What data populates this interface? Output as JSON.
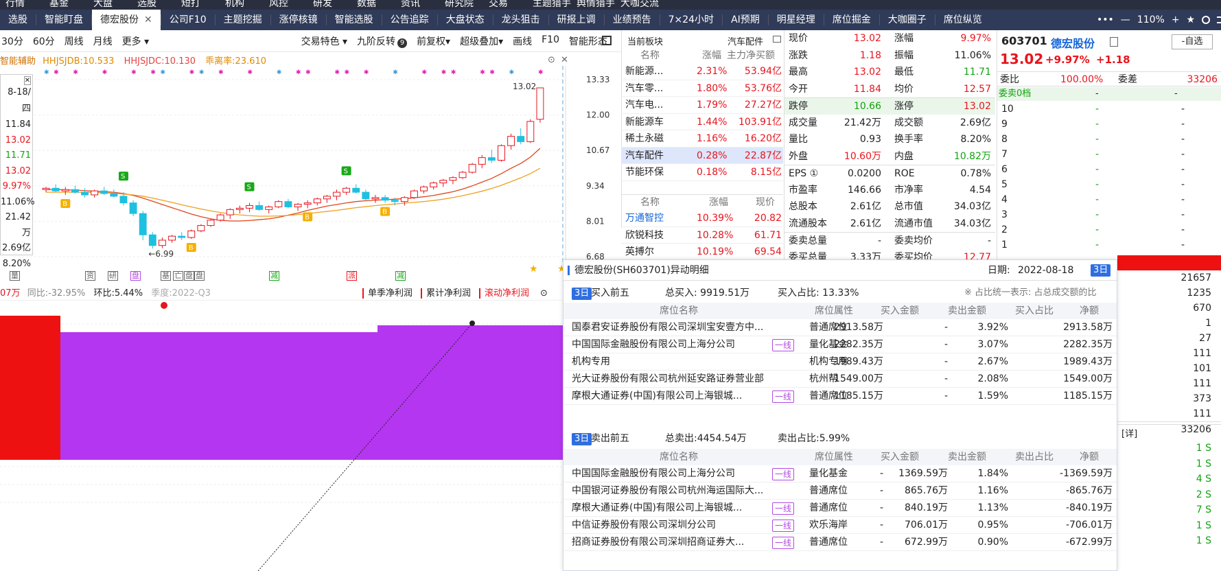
{
  "topnav": [
    "行情",
    "基金",
    "大盘",
    "选股",
    "短打",
    "机构",
    "风控",
    "研发",
    "数据",
    "资讯",
    "研究院",
    "交易",
    "主题猎手",
    "舆情猎手",
    "大咖交流"
  ],
  "tabs": [
    {
      "label": "选股",
      "active": false
    },
    {
      "label": "智能盯盘",
      "active": false
    },
    {
      "label": "德宏股份",
      "active": true
    },
    {
      "label": "公司F10",
      "active": false
    },
    {
      "label": "主题挖掘",
      "active": false
    },
    {
      "label": "涨停核镜",
      "active": false
    },
    {
      "label": "智能选股",
      "active": false
    },
    {
      "label": "公告追踪",
      "active": false
    },
    {
      "label": "大盘状态",
      "active": false
    },
    {
      "label": "龙头狙击",
      "active": false
    },
    {
      "label": "研报上调",
      "active": false
    },
    {
      "label": "业绩预告",
      "active": false
    },
    {
      "label": "7×24小时",
      "active": false
    },
    {
      "label": "AI预期",
      "active": false
    },
    {
      "label": "明星经理",
      "active": false
    },
    {
      "label": "席位掘金",
      "active": false
    },
    {
      "label": "大咖圈子",
      "active": false
    },
    {
      "label": "席位纵览",
      "active": false
    }
  ],
  "window": {
    "zoom": "110%",
    "more": "•••",
    "minimize": "—",
    "plus": "+",
    "star": "★",
    "search": "搜索"
  },
  "toolbar": {
    "periods": [
      "30分",
      "60分",
      "周线",
      "月线",
      "更多 ▾"
    ],
    "right": [
      "交易特色 ▾",
      "九阶反转",
      "前复权▾",
      "超级叠加▾",
      "画线",
      "F10",
      "智能形态"
    ],
    "nine_badge": "9"
  },
  "indicator": {
    "name": "智能辅助",
    "v1": "HHJSJDB:10.533",
    "v2": "HHJSJDC:10.130",
    "v3": "乖离率:23.610"
  },
  "tooltip": {
    "date": "8-18/四",
    "values": [
      {
        "v": "11.84",
        "c": "k"
      },
      {
        "v": "13.02",
        "c": "r"
      },
      {
        "v": "11.71",
        "c": "g"
      },
      {
        "v": "13.02",
        "c": "r"
      },
      {
        "v": "9.97%",
        "c": "r"
      },
      {
        "v": "11.06%",
        "c": "k"
      },
      {
        "v": "21.42万",
        "c": "k"
      },
      {
        "v": "2.69亿",
        "c": "k"
      },
      {
        "v": "8.20%",
        "c": "k"
      }
    ]
  },
  "price_axis": [
    "13.33",
    "12.00",
    "10.67",
    "9.34",
    "8.01",
    "6.68"
  ],
  "chart_marks": {
    "high": "13.02",
    "low": "←6.99"
  },
  "chart_data": {
    "type": "candlestick",
    "y_range": [
      6.68,
      13.33
    ],
    "series": [
      {
        "name": "K线",
        "values": [
          [
            9.2,
            9.3,
            9.1,
            9.25
          ],
          [
            9.25,
            9.4,
            9.1,
            9.15
          ],
          [
            9.15,
            9.3,
            9.0,
            9.2
          ],
          [
            9.2,
            9.35,
            9.05,
            9.1
          ],
          [
            9.1,
            9.25,
            8.9,
            9.0
          ],
          [
            9.0,
            9.2,
            8.9,
            9.15
          ],
          [
            9.15,
            9.3,
            9.0,
            9.05
          ],
          [
            9.05,
            9.2,
            8.9,
            8.95
          ],
          [
            8.95,
            9.1,
            8.6,
            8.7
          ],
          [
            8.7,
            8.8,
            8.2,
            8.3
          ],
          [
            8.3,
            8.4,
            7.3,
            7.5
          ],
          [
            7.5,
            7.6,
            6.99,
            7.1
          ],
          [
            7.1,
            7.4,
            7.0,
            7.3
          ],
          [
            7.3,
            7.5,
            7.2,
            7.45
          ],
          [
            7.45,
            7.6,
            7.3,
            7.4
          ],
          [
            7.4,
            7.7,
            7.35,
            7.65
          ],
          [
            7.65,
            7.9,
            7.6,
            7.85
          ],
          [
            7.85,
            8.1,
            7.8,
            8.05
          ],
          [
            8.05,
            8.3,
            8.0,
            8.25
          ],
          [
            8.25,
            8.5,
            8.1,
            8.45
          ],
          [
            8.45,
            8.6,
            8.3,
            8.5
          ],
          [
            8.5,
            8.7,
            8.35,
            8.6
          ],
          [
            8.6,
            8.75,
            8.4,
            8.45
          ],
          [
            8.45,
            8.6,
            8.3,
            8.55
          ],
          [
            8.55,
            8.8,
            8.5,
            8.75
          ],
          [
            8.75,
            8.85,
            8.5,
            8.55
          ],
          [
            8.55,
            8.7,
            8.4,
            8.65
          ],
          [
            8.65,
            8.8,
            8.5,
            8.7
          ],
          [
            8.7,
            8.9,
            8.6,
            8.85
          ],
          [
            8.85,
            9.0,
            8.7,
            8.95
          ],
          [
            8.95,
            9.2,
            8.8,
            9.1
          ],
          [
            9.1,
            9.3,
            9.0,
            9.25
          ],
          [
            9.25,
            9.4,
            9.05,
            9.1
          ],
          [
            9.1,
            9.2,
            8.8,
            8.85
          ],
          [
            8.85,
            9.0,
            8.7,
            8.9
          ],
          [
            8.9,
            9.0,
            8.7,
            8.8
          ],
          [
            8.8,
            8.9,
            8.6,
            8.75
          ],
          [
            8.75,
            8.95,
            8.6,
            8.9
          ],
          [
            8.9,
            9.2,
            8.85,
            9.15
          ],
          [
            9.15,
            9.35,
            9.05,
            9.3
          ],
          [
            9.3,
            9.5,
            9.2,
            9.45
          ],
          [
            9.45,
            9.6,
            9.3,
            9.55
          ],
          [
            9.55,
            9.7,
            9.4,
            9.65
          ],
          [
            9.65,
            9.9,
            9.6,
            9.85
          ],
          [
            9.85,
            10.2,
            9.8,
            10.15
          ],
          [
            10.15,
            10.5,
            10.0,
            10.4
          ],
          [
            10.4,
            10.7,
            10.2,
            10.3
          ],
          [
            10.3,
            10.9,
            10.25,
            10.85
          ],
          [
            10.85,
            11.3,
            10.7,
            11.2
          ],
          [
            11.2,
            11.5,
            10.9,
            11.0
          ],
          [
            11.0,
            11.84,
            10.95,
            11.76
          ],
          [
            11.84,
            13.02,
            11.71,
            13.02
          ]
        ]
      },
      {
        "name": "MA10",
        "values": [
          9.2,
          9.2,
          9.19,
          9.18,
          9.16,
          9.14,
          9.12,
          9.1,
          9.05,
          8.98,
          8.88,
          8.76,
          8.64,
          8.52,
          8.4,
          8.28,
          8.18,
          8.1,
          8.05,
          8.02,
          8.02,
          8.04,
          8.07,
          8.1,
          8.16,
          8.24,
          8.32,
          8.42,
          8.5,
          8.58,
          8.64,
          8.7,
          8.75,
          8.78,
          8.8,
          8.82,
          8.84,
          8.86,
          8.89,
          8.93,
          8.98,
          9.05,
          9.12,
          9.22,
          9.34,
          9.48,
          9.62,
          9.8,
          10.0,
          10.18,
          10.42,
          10.75
        ]
      },
      {
        "name": "MA20",
        "values": [
          9.1,
          9.1,
          9.1,
          9.1,
          9.1,
          9.09,
          9.08,
          9.06,
          9.03,
          9.0,
          8.95,
          8.88,
          8.8,
          8.72,
          8.63,
          8.55,
          8.47,
          8.4,
          8.34,
          8.29,
          8.25,
          8.22,
          8.2,
          8.2,
          8.21,
          8.23,
          8.26,
          8.3,
          8.34,
          8.38,
          8.42,
          8.47,
          8.52,
          8.56,
          8.6,
          8.63,
          8.66,
          8.69,
          8.72,
          8.75,
          8.79,
          8.84,
          8.9,
          8.97,
          9.05,
          9.14,
          9.24,
          9.36,
          9.5,
          9.64,
          9.8,
          10.0
        ]
      }
    ]
  },
  "signals_row": [
    "量",
    "资",
    "研",
    "盘",
    "基",
    "亡",
    "盘",
    "盘",
    "减",
    "派",
    "减"
  ],
  "fundamental": {
    "v": "07万",
    "yoy": "同比:-32.95%",
    "qoq": "环比:5.44%",
    "season": "季度:2022-Q3",
    "buttons": [
      "单季净利润",
      "累计净利润",
      "滚动净利润"
    ]
  },
  "sector": {
    "header": "当前板块",
    "current": "汽车配件",
    "cols": [
      "名称",
      "涨幅",
      "主力净买额"
    ],
    "rows": [
      [
        "新能源...",
        "2.31%",
        "53.94亿"
      ],
      [
        "汽车零...",
        "1.80%",
        "53.76亿"
      ],
      [
        "汽车电...",
        "1.79%",
        "27.27亿"
      ],
      [
        "新能源车",
        "1.44%",
        "103.91亿"
      ],
      [
        "稀土永磁",
        "1.16%",
        "16.20亿"
      ],
      [
        "汽车配件",
        "0.28%",
        "22.87亿"
      ],
      [
        "节能环保",
        "0.18%",
        "8.15亿"
      ]
    ]
  },
  "stocks": {
    "cols": [
      "名称",
      "涨幅",
      "现价"
    ],
    "rows": [
      [
        "万通智控",
        "10.39%",
        "20.82"
      ],
      [
        "欣锐科技",
        "10.28%",
        "61.71"
      ],
      [
        "英搏尔",
        "10.19%",
        "69.54"
      ]
    ]
  },
  "quote": [
    [
      "现价",
      "13.02",
      "r",
      "涨幅",
      "9.97%",
      "r"
    ],
    [
      "涨跌",
      "1.18",
      "r",
      "振幅",
      "11.06%",
      "k"
    ],
    [
      "最高",
      "13.02",
      "r",
      "最低",
      "11.71",
      "g"
    ],
    [
      "今开",
      "11.84",
      "r",
      "均价",
      "12.57",
      "r"
    ],
    [
      "跌停",
      "10.66",
      "g",
      "涨停",
      "13.02",
      "r"
    ],
    [
      "成交量",
      "21.42万",
      "k",
      "成交额",
      "2.69亿",
      "k"
    ],
    [
      "量比",
      "0.93",
      "k",
      "换手率",
      "8.20%",
      "k"
    ],
    [
      "外盘",
      "10.60万",
      "r",
      "内盘",
      "10.82万",
      "g"
    ],
    [
      "EPS ①",
      "0.0200",
      "k",
      "ROE",
      "0.78%",
      "k"
    ],
    [
      "市盈率",
      "146.66",
      "k",
      "市净率",
      "4.54",
      "k"
    ],
    [
      "总股本",
      "2.61亿",
      "k",
      "总市值",
      "34.03亿",
      "k"
    ],
    [
      "流通股本",
      "2.61亿",
      "k",
      "流通市值",
      "34.03亿",
      "k"
    ],
    [
      "委卖总量",
      "-",
      "k",
      "委卖均价",
      "-",
      "k"
    ],
    [
      "委买总量",
      "3.33万",
      "k",
      "委买均价",
      "12.77",
      "r"
    ]
  ],
  "stockhead": {
    "code": "603701",
    "name": "德宏股份",
    "price": "13.02",
    "pct": "+9.97%",
    "chg": "+1.18",
    "watch": "-自选"
  },
  "orderbook": {
    "wb_label": "委比",
    "wb": "100.00%",
    "wc_label": "委差",
    "wc": "33206",
    "sell0": "委卖0档",
    "levels": [
      "10",
      "9",
      "8",
      "7",
      "6",
      "5",
      "4",
      "3",
      "2",
      "1"
    ],
    "dash": "-"
  },
  "right_vals": [
    "21657",
    "1235",
    "670",
    "1",
    "27",
    "111",
    "101",
    "111",
    "373",
    "111",
    "33206"
  ],
  "detail_label": "[详]",
  "trades": [
    "1 S",
    "1 S",
    "4 S",
    "2 S",
    "7 S",
    "1 S",
    "1 S"
  ],
  "popup": {
    "title": "德宏股份(SH603701)异动明细",
    "date_label": "日期:",
    "date": "2022-08-18",
    "period": "3日",
    "buy": {
      "title": "买入前五",
      "total": "总买入: 9919.51万",
      "ratio": "买入占比: 13.33%",
      "note": "※ 占比统一表示: 占总成交额的比",
      "cols": [
        "席位名称",
        "席位属性",
        "买入金额",
        "卖出金额",
        "买入占比",
        "净额"
      ],
      "rows": [
        {
          "name": "国泰君安证券股份有限公司深圳宝安壹方中...",
          "tag": "",
          "attr": "普通席位",
          "buy": "2913.58万",
          "sell": "-",
          "pct": "3.92%",
          "net": "2913.58万"
        },
        {
          "name": "中国国际金融股份有限公司上海分公司",
          "tag": "一线",
          "attr": "量化基金",
          "buy": "2282.35万",
          "sell": "-",
          "pct": "3.07%",
          "net": "2282.35万"
        },
        {
          "name": "机构专用",
          "tag": "",
          "attr": "机构专用",
          "buy": "1989.43万",
          "sell": "-",
          "pct": "2.67%",
          "net": "1989.43万"
        },
        {
          "name": "光大证券股份有限公司杭州延安路证券营业部",
          "tag": "",
          "attr": "杭州帮",
          "buy": "1549.00万",
          "sell": "-",
          "pct": "2.08%",
          "net": "1549.00万"
        },
        {
          "name": "摩根大通证券(中国)有限公司上海银城...",
          "tag": "一线",
          "attr": "普通席位",
          "buy": "1185.15万",
          "sell": "-",
          "pct": "1.59%",
          "net": "1185.15万"
        }
      ]
    },
    "sell": {
      "title": "卖出前五",
      "total": "总卖出:4454.54万",
      "ratio": "卖出占比:5.99%",
      "cols": [
        "席位名称",
        "席位属性",
        "买入金额",
        "卖出金额",
        "卖出占比",
        "净额"
      ],
      "rows": [
        {
          "name": "中国国际金融股份有限公司上海分公司",
          "tag": "一线",
          "attr": "量化基金",
          "buy": "-",
          "sell": "1369.59万",
          "pct": "1.84%",
          "net": "-1369.59万"
        },
        {
          "name": "中国银河证券股份有限公司杭州海运国际大...",
          "tag": "",
          "attr": "普通席位",
          "buy": "-",
          "sell": "865.76万",
          "pct": "1.16%",
          "net": "-865.76万"
        },
        {
          "name": "摩根大通证券(中国)有限公司上海银城...",
          "tag": "一线",
          "attr": "普通席位",
          "buy": "-",
          "sell": "840.19万",
          "pct": "1.13%",
          "net": "-840.19万"
        },
        {
          "name": "中信证券股份有限公司深圳分公司",
          "tag": "一线",
          "attr": "欢乐海岸",
          "buy": "-",
          "sell": "706.01万",
          "pct": "0.95%",
          "net": "-706.01万"
        },
        {
          "name": "招商证券股份有限公司深圳招商证券大...",
          "tag": "一线",
          "attr": "普通席位",
          "buy": "-",
          "sell": "672.99万",
          "pct": "0.90%",
          "net": "-672.99万"
        }
      ]
    }
  },
  "colors": {
    "up": "#e8141c",
    "down": "#11a310",
    "bar_red": "#ee1111",
    "bar_purple": "#b536f0",
    "ma10": "#e0451a",
    "ma20": "#f0a020",
    "accent": "#2f6ee0"
  }
}
